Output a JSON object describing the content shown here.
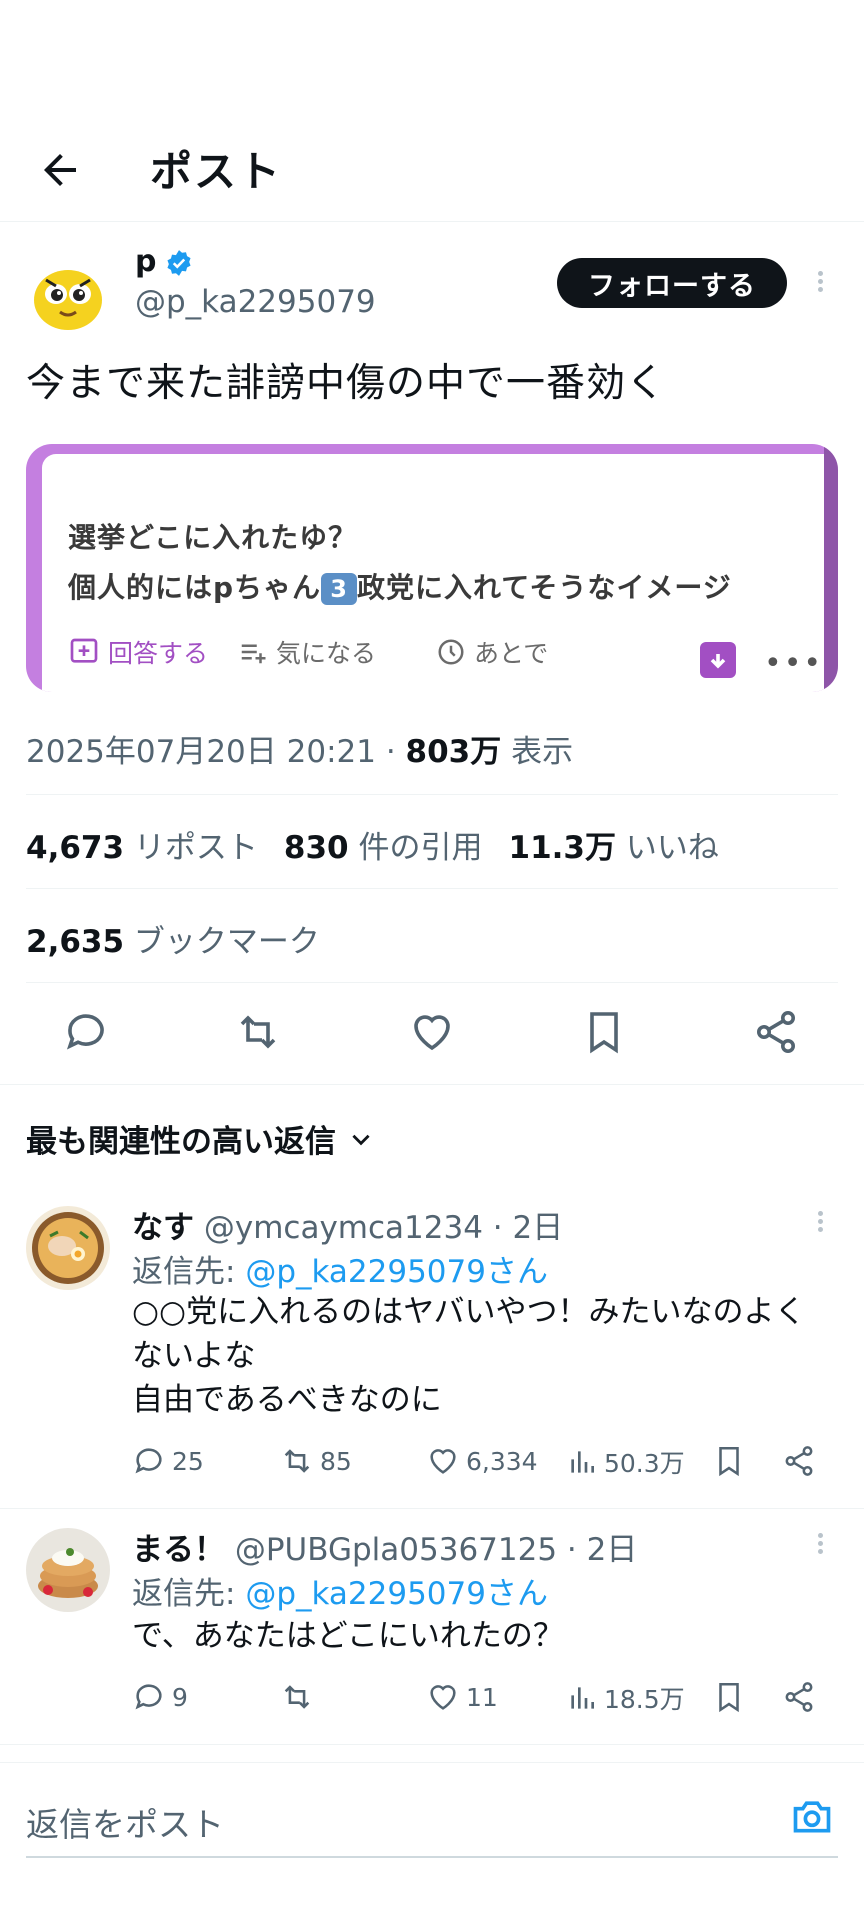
{
  "header": {
    "title": "ポスト"
  },
  "post": {
    "author_name": "p",
    "author_handle": "@p_ka2295079",
    "follow_label": "フォローする",
    "text": "今まで来た誹謗中傷の中で一番効く",
    "card": {
      "line1": "選挙どこに入れたゆ？",
      "line2_before": "個人的にはpちゃん",
      "line2_badge": "3",
      "line2_after": "政党に入れてそうなイメージ",
      "action_answer": "回答する",
      "action_interested": "気になる",
      "action_later": "あとで"
    },
    "timestamp": "2025年07月20日 20:21",
    "views_value": "803万",
    "views_label": "表示",
    "reposts_value": "4,673",
    "reposts_label": "リポスト",
    "quotes_value": "830",
    "quotes_label": "件の引用",
    "likes_value": "11.3万",
    "likes_label": "いいね",
    "bookmarks_value": "2,635",
    "bookmarks_label": "ブックマーク"
  },
  "replies_sort": "最も関連性の高い返信",
  "replies": [
    {
      "name": "なす",
      "handle": "@ymcaymca1234",
      "time": "2日",
      "reply_to_prefix": "返信先: ",
      "reply_to": "@p_ka2295079さん",
      "text_lines": [
        "○○党に入れるのはヤバいやつ！みたいなのよく",
        "ないよな",
        "自由であるべきなのに"
      ],
      "replies": "25",
      "reposts": "85",
      "likes": "6,334",
      "views": "50.3万"
    },
    {
      "name": "まる！",
      "handle": "@PUBGpla05367125",
      "time": "2日",
      "reply_to_prefix": "返信先: ",
      "reply_to": "@p_ka2295079さん",
      "text_lines": [
        "で、あなたはどこにいれたの？"
      ],
      "replies": "9",
      "reposts": "",
      "likes": "11",
      "views": "18.5万"
    }
  ],
  "compose": {
    "placeholder": "返信をポスト"
  },
  "colors": {
    "accent": "#1d9bf0",
    "text": "#0f1419",
    "muted": "#536471",
    "card_purple": "#a24fc3"
  },
  "icons": [
    "back-arrow-icon",
    "verified-badge-icon",
    "more-icon",
    "reply-icon",
    "repost-icon",
    "like-icon",
    "bookmark-icon",
    "share-icon",
    "views-icon",
    "chevron-down-icon",
    "camera-icon",
    "archive-icon"
  ]
}
